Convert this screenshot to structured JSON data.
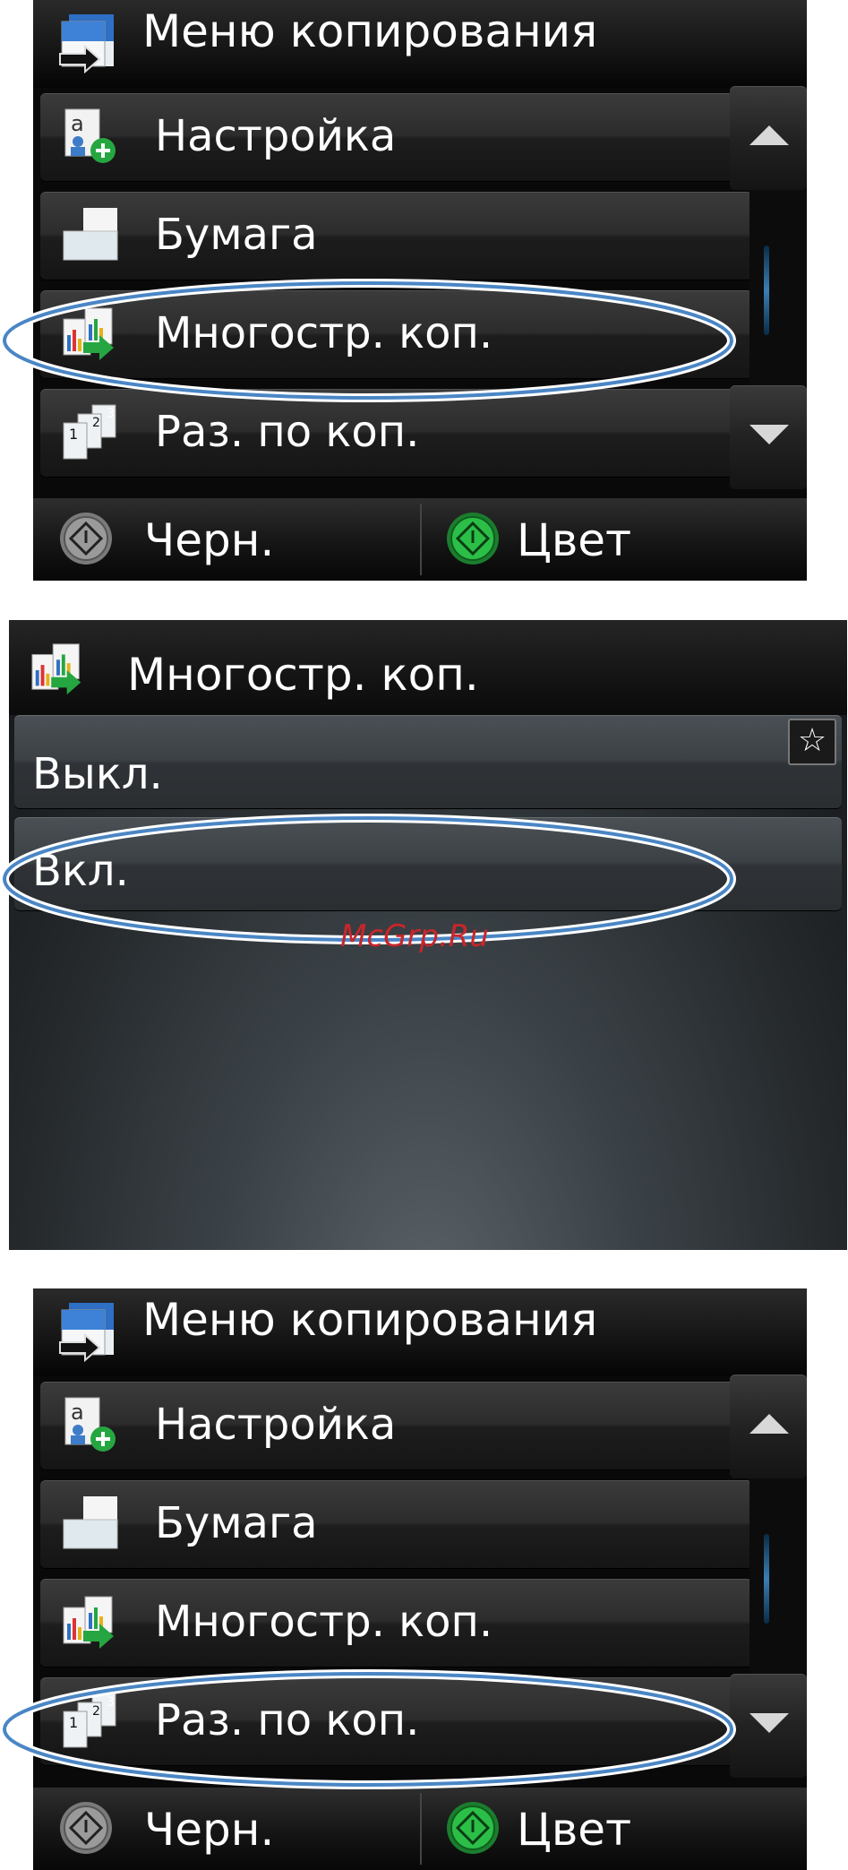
{
  "screens": [
    {
      "title": "Меню копирования",
      "items": [
        {
          "label": "Настройка",
          "icon": "settings-doc-icon"
        },
        {
          "label": "Бумага",
          "icon": "paper-icon"
        },
        {
          "label": "Многостр. коп.",
          "icon": "multipage-copy-icon"
        },
        {
          "label": "Раз. по коп.",
          "icon": "collate-icon"
        }
      ],
      "highlighted_item": "Многостр. коп.",
      "footer": {
        "bw_label": "Черн.",
        "color_label": "Цвет"
      }
    },
    {
      "title": "Многостр. коп.",
      "options": [
        {
          "label": "Выкл."
        },
        {
          "label": "Вкл."
        }
      ],
      "highlighted_option": "Вкл.",
      "favorite_icon": "star-icon"
    },
    {
      "title": "Меню копирования",
      "items": [
        {
          "label": "Настройка",
          "icon": "settings-doc-icon"
        },
        {
          "label": "Бумага",
          "icon": "paper-icon"
        },
        {
          "label": "Многостр. коп.",
          "icon": "multipage-copy-icon"
        },
        {
          "label": "Раз. по коп.",
          "icon": "collate-icon"
        }
      ],
      "highlighted_item": "Раз. по коп.",
      "footer": {
        "bw_label": "Черн.",
        "color_label": "Цвет"
      }
    }
  ],
  "watermark": "McGrp.Ru",
  "colors": {
    "highlight_ring": "#4a86c5",
    "start_green": "#1faa3a",
    "scroll_thumb": "#3a7fb5",
    "watermark": "#c8262a"
  }
}
